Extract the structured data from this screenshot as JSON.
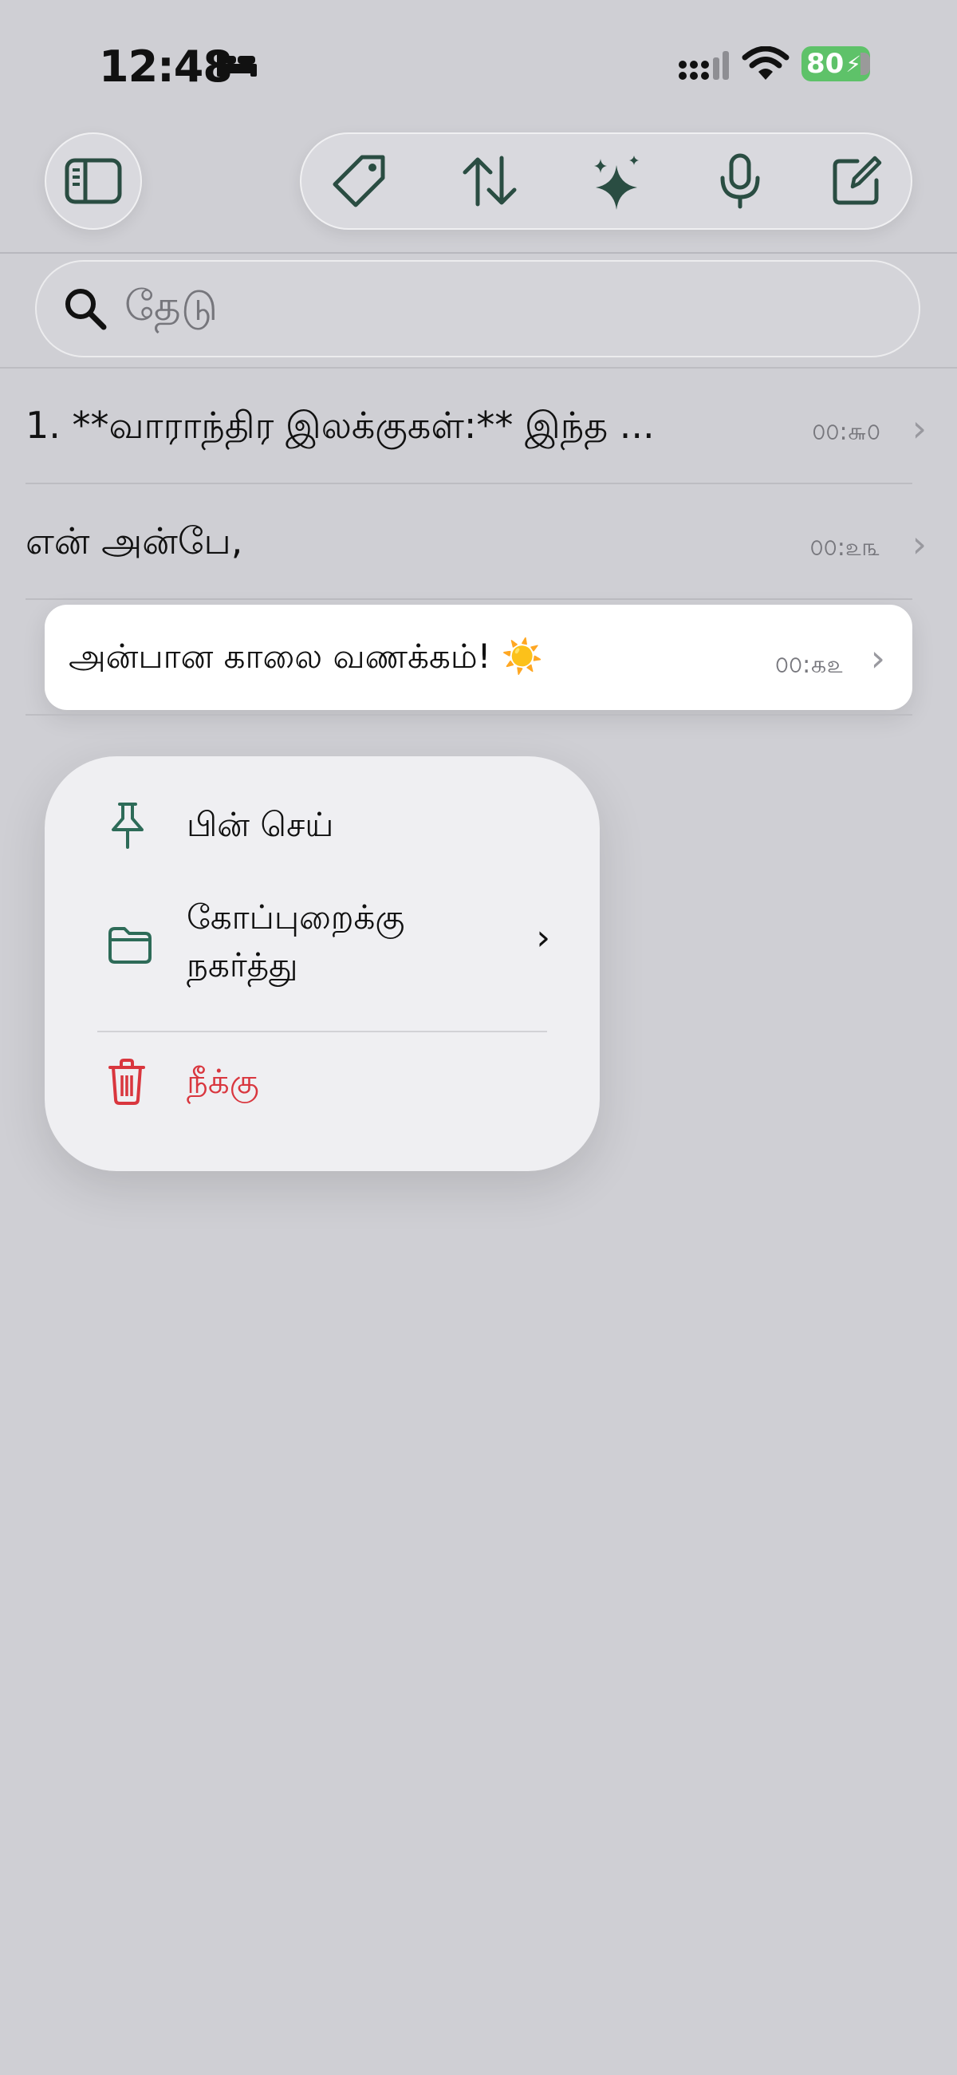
{
  "status_bar": {
    "time": "12:48",
    "battery": "80"
  },
  "search": {
    "placeholder": "தேடு"
  },
  "notes": [
    {
      "title": "1. **வாராந்திர இலக்குகள்:** இந்த  ...",
      "time": "௦௦:௬௦"
    },
    {
      "title": "என் அன்பே,",
      "time": "௦௦:௨௩"
    },
    {
      "title": "அன்பான காலை வணக்கம்! ☀️",
      "time": "௦௦:௧௨"
    }
  ],
  "context_menu": {
    "pin": "பின் செய்",
    "move_line1": "கோப்புறைக்கு",
    "move_line2": "நகர்த்து",
    "delete": "நீக்கு"
  },
  "colors": {
    "accent": "#2d6b58",
    "delete": "#d9363e",
    "battery": "#5ec269"
  }
}
